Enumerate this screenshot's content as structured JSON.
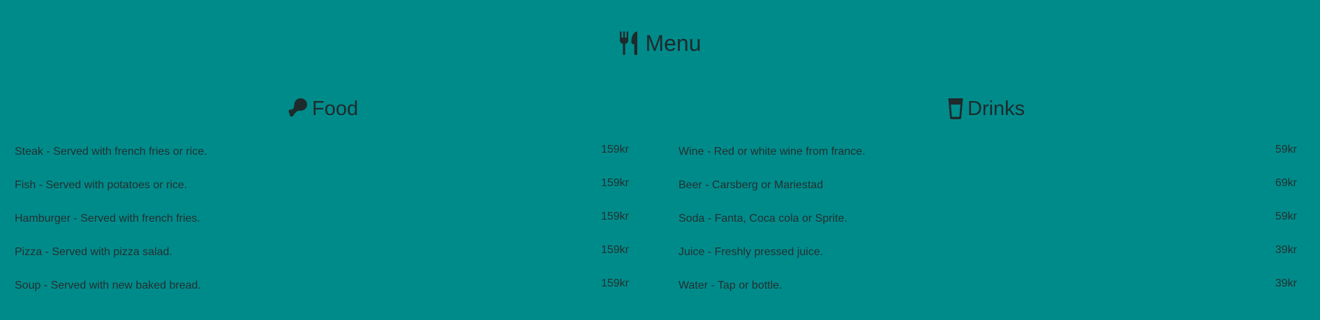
{
  "header": {
    "title": "Menu",
    "icon": "utensils-icon"
  },
  "food": {
    "title": "Food",
    "icon": "drumstick-icon",
    "items": [
      {
        "description": "Steak - Served with french fries or rice.",
        "price": "159kr"
      },
      {
        "description": "Fish - Served with potatoes or rice.",
        "price": "159kr"
      },
      {
        "description": "Hamburger - Served with french fries.",
        "price": "159kr"
      },
      {
        "description": "Pizza - Served with pizza salad.",
        "price": "159kr"
      },
      {
        "description": "Soup - Served with new baked bread.",
        "price": "159kr"
      }
    ]
  },
  "drinks": {
    "title": "Drinks",
    "icon": "glass-icon",
    "items": [
      {
        "description": "Wine - Red or white wine from france.",
        "price": "59kr"
      },
      {
        "description": "Beer - Carsberg or Mariestad",
        "price": "69kr"
      },
      {
        "description": "Soda - Fanta, Coca cola or Sprite.",
        "price": "59kr"
      },
      {
        "description": "Juice - Freshly pressed juice.",
        "price": "39kr"
      },
      {
        "description": "Water - Tap or bottle.",
        "price": "39kr"
      }
    ]
  },
  "colors": {
    "background": "#008b8b",
    "text": "#1f2a2c"
  }
}
